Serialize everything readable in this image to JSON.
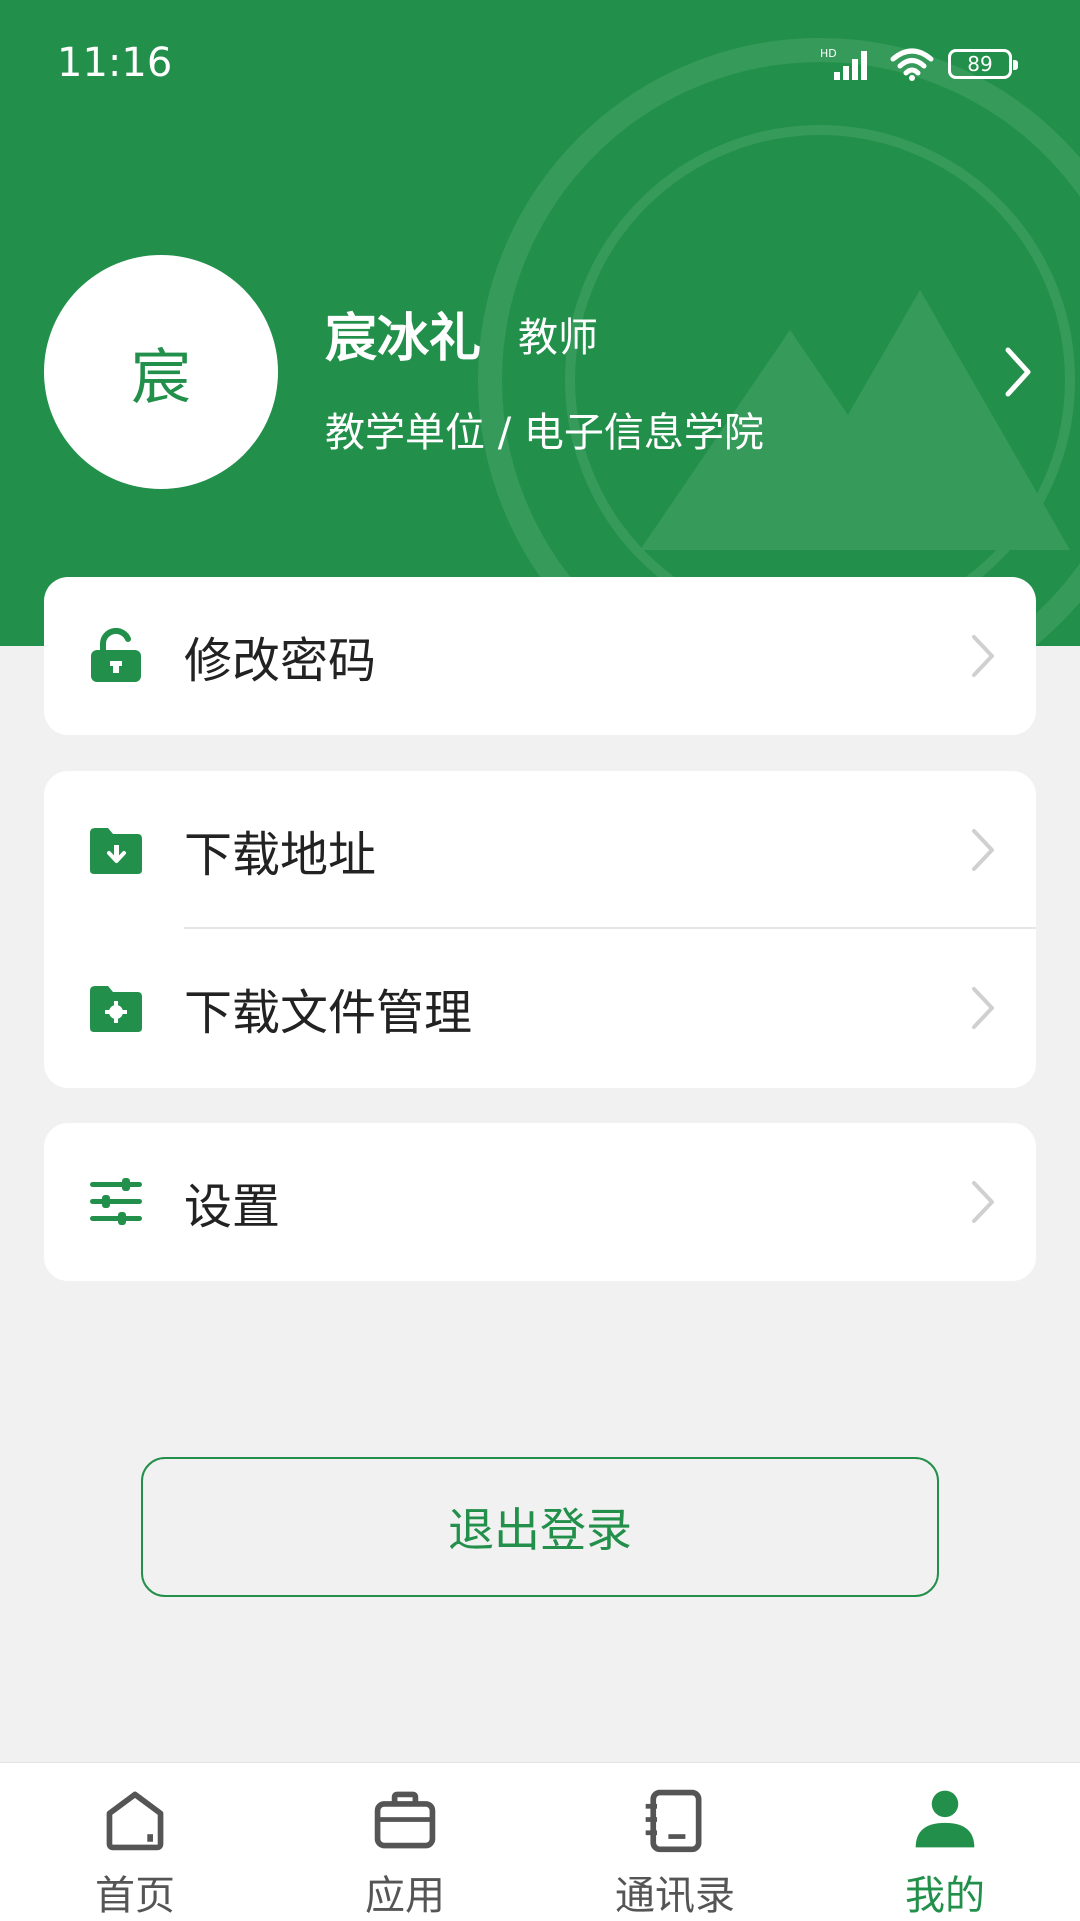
{
  "status_bar": {
    "time": "11:16",
    "network_label": "HD",
    "battery_level": "89"
  },
  "profile": {
    "avatar_text": "宸",
    "name": "宸冰礼",
    "role": "教师",
    "department": "教学单位 / 电子信息学院"
  },
  "menu": {
    "change_password": "修改密码",
    "download_address": "下载地址",
    "download_file_manage": "下载文件管理",
    "settings": "设置"
  },
  "logout_label": "退出登录",
  "tabs": [
    {
      "label": "首页",
      "icon": "home-icon",
      "active": false
    },
    {
      "label": "应用",
      "icon": "briefcase-icon",
      "active": false
    },
    {
      "label": "通讯录",
      "icon": "contacts-book-icon",
      "active": false
    },
    {
      "label": "我的",
      "icon": "user-icon",
      "active": true
    }
  ],
  "colors": {
    "accent": "#22904a",
    "background": "#f1f1f1",
    "tab_inactive": "#555555"
  }
}
